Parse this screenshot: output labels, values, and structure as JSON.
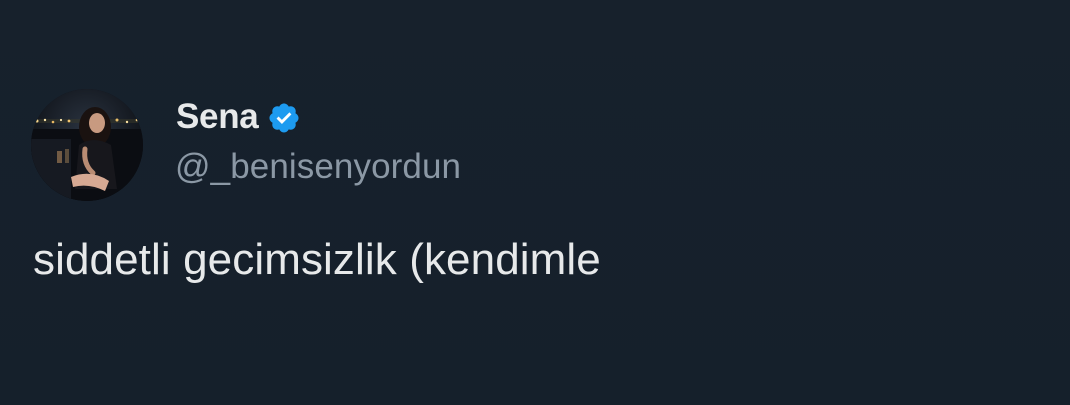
{
  "tweet": {
    "author": {
      "display_name": "Sena",
      "handle": "@_benisenyordun",
      "verified": true,
      "verified_badge_color": "#1d9bf0"
    },
    "text": "siddetli gecimsizlik (kendimle"
  },
  "theme": {
    "background": "#15202b",
    "text_primary": "#e7e9ea",
    "text_secondary": "#8b98a5"
  }
}
